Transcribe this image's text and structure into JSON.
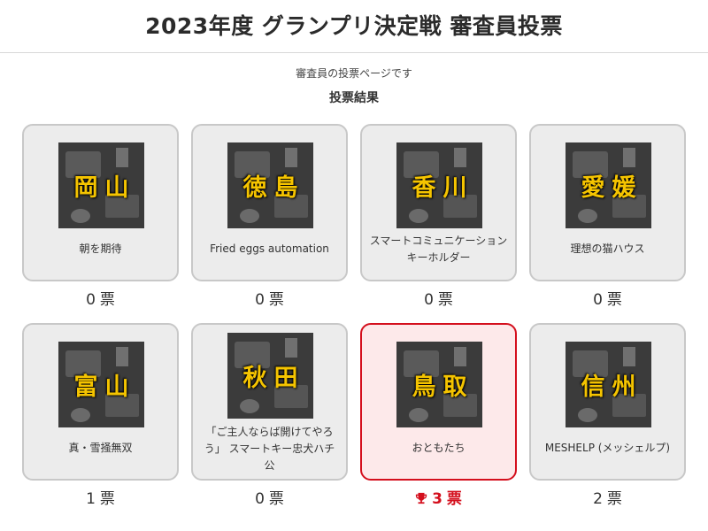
{
  "page": {
    "title": "2023年度 グランプリ決定戦 審査員投票",
    "subtitle": "審査員の投票ページです",
    "results_heading": "投票結果",
    "vote_unit": "票"
  },
  "colors": {
    "winner_accent": "#d40f1d",
    "winner_bg": "#fde9ea",
    "card_bg": "#ececec",
    "card_border": "#c8c8c8",
    "prefecture_text": "#f5c400"
  },
  "entries": [
    {
      "prefecture": "岡山",
      "label": "朝を期待",
      "votes": "0"
    },
    {
      "prefecture": "徳島",
      "label": "Fried eggs automation",
      "votes": "0"
    },
    {
      "prefecture": "香川",
      "label": "スマートコミュニケーションキーホルダー",
      "votes": "0"
    },
    {
      "prefecture": "愛媛",
      "label": "理想の猫ハウス",
      "votes": "0"
    },
    {
      "prefecture": "富山",
      "label": "真・雪掻無双",
      "votes": "1"
    },
    {
      "prefecture": "秋田",
      "label": "「ご主人ならば開けてやろう」 スマートキー忠犬ハチ公",
      "votes": "0"
    },
    {
      "prefecture": "鳥取",
      "label": "おともたち",
      "votes": "3",
      "winner": true,
      "icon": "trophy-icon"
    },
    {
      "prefecture": "信州",
      "label": "MESHELP (メッシェルプ)",
      "votes": "2"
    }
  ]
}
